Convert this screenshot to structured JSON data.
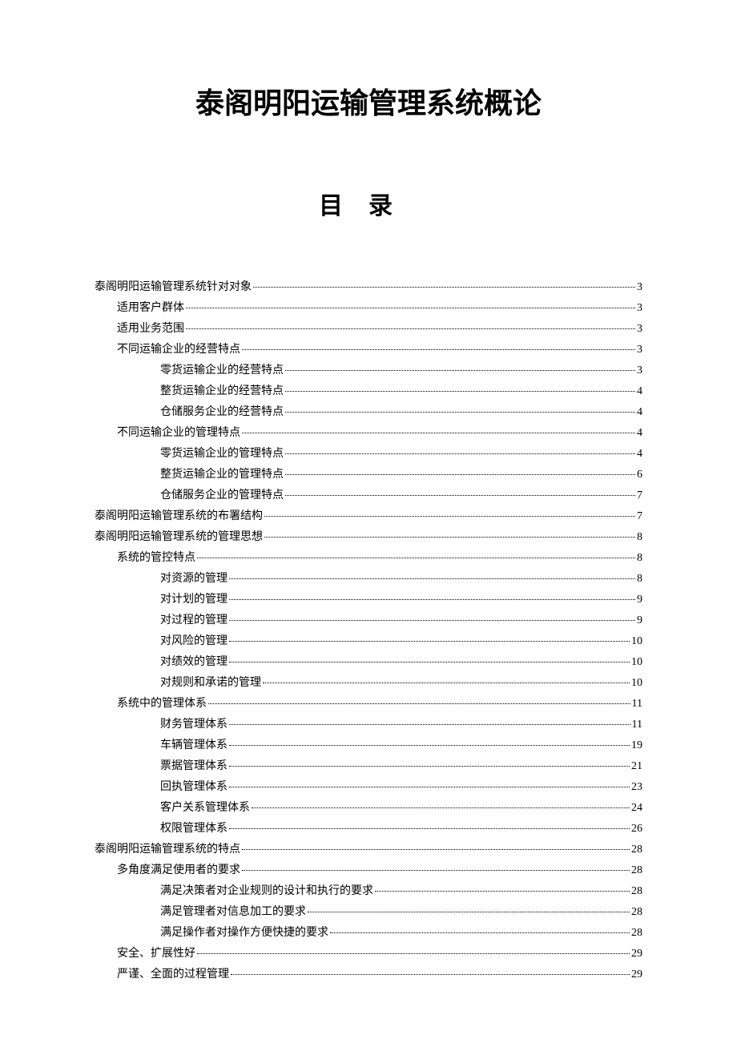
{
  "title": "泰阁明阳运输管理系统概论",
  "toc_heading": "目录",
  "toc": [
    {
      "label": "泰阁明阳运输管理系统针对对象",
      "page": "3",
      "indent": 0
    },
    {
      "label": "适用客户群体",
      "page": "3",
      "indent": 1
    },
    {
      "label": "适用业务范围",
      "page": "3",
      "indent": 1
    },
    {
      "label": "不同运输企业的经营特点",
      "page": "3",
      "indent": 1
    },
    {
      "label": "零货运输企业的经营特点",
      "page": "3",
      "indent": 2
    },
    {
      "label": "整货运输企业的经营特点",
      "page": "4",
      "indent": 2
    },
    {
      "label": "仓储服务企业的经营特点",
      "page": "4",
      "indent": 2
    },
    {
      "label": "不同运输企业的管理特点",
      "page": "4",
      "indent": 1
    },
    {
      "label": "零货运输企业的管理特点",
      "page": "4",
      "indent": 2
    },
    {
      "label": "整货运输企业的管理特点",
      "page": "6",
      "indent": 2
    },
    {
      "label": "仓储服务企业的管理特点",
      "page": "7",
      "indent": 2
    },
    {
      "label": "泰阁明阳运输管理系统的布署结构",
      "page": "7",
      "indent": 0
    },
    {
      "label": "泰阁明阳运输管理系统的管理思想",
      "page": "8",
      "indent": 0
    },
    {
      "label": "系统的管控特点",
      "page": "8",
      "indent": 1
    },
    {
      "label": "对资源的管理",
      "page": "8",
      "indent": 2
    },
    {
      "label": "对计划的管理",
      "page": "9",
      "indent": 2
    },
    {
      "label": "对过程的管理",
      "page": "9",
      "indent": 2
    },
    {
      "label": "对风险的管理",
      "page": "10",
      "indent": 2
    },
    {
      "label": "对绩效的管理",
      "page": "10",
      "indent": 2
    },
    {
      "label": "对规则和承诺的管理",
      "page": "10",
      "indent": 2
    },
    {
      "label": "系统中的管理体系",
      "page": "11",
      "indent": 1
    },
    {
      "label": "财务管理体系",
      "page": "11",
      "indent": 2
    },
    {
      "label": "车辆管理体系",
      "page": "19",
      "indent": 2
    },
    {
      "label": "票据管理体系",
      "page": "21",
      "indent": 2
    },
    {
      "label": "回执管理体系",
      "page": "23",
      "indent": 2
    },
    {
      "label": "客户关系管理体系",
      "page": "24",
      "indent": 2
    },
    {
      "label": "权限管理体系",
      "page": "26",
      "indent": 2
    },
    {
      "label": "泰阁明阳运输管理系统的特点",
      "page": "28",
      "indent": 0
    },
    {
      "label": "多角度满足使用者的要求",
      "page": "28",
      "indent": 1
    },
    {
      "label": "满足决策者对企业规则的设计和执行的要求",
      "page": "28",
      "indent": 2
    },
    {
      "label": "满足管理者对信息加工的要求",
      "page": "28",
      "indent": 2
    },
    {
      "label": "满足操作者对操作方便快捷的要求",
      "page": "28",
      "indent": 2
    },
    {
      "label": "安全、扩展性好",
      "page": "29",
      "indent": 1
    },
    {
      "label": "严谨、全面的过程管理",
      "page": "29",
      "indent": 1
    }
  ]
}
